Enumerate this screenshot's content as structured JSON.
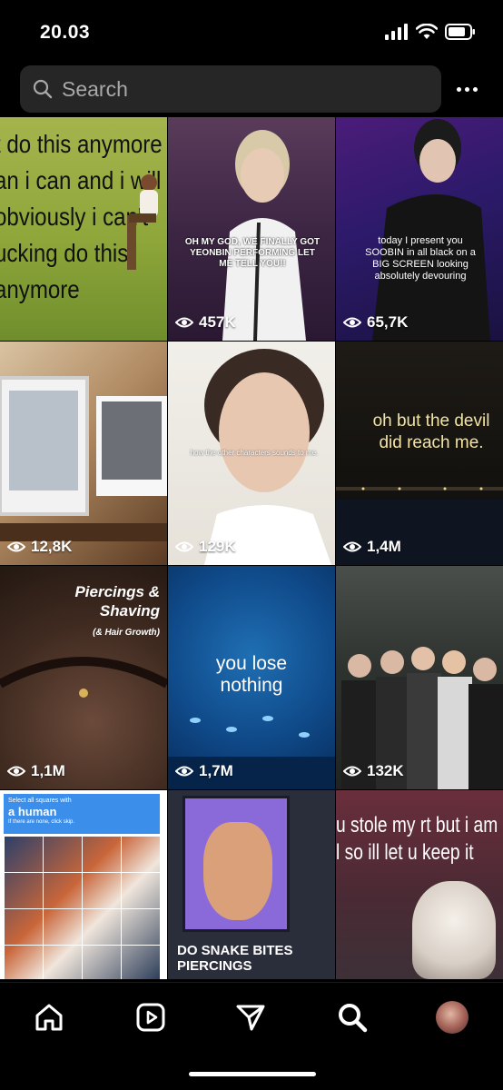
{
  "status_bar": {
    "time": "20.03"
  },
  "search": {
    "placeholder": "Search"
  },
  "grid": {
    "tiles": [
      {
        "caption": "t do this anymore an i can and i will obviously i can't ucking do this anymore",
        "views": ""
      },
      {
        "caption": "OH MY GOD, WE FINALLY GOT YEONBIN PERFORMING LET ME TELL YOU!!",
        "views": "457K"
      },
      {
        "caption": "today I present you SOOBIN in all black on a BIG SCREEN looking absolutely devouring",
        "views": "65,7K"
      },
      {
        "caption": "",
        "views": "12,8K"
      },
      {
        "caption": "how the other characters sounds to me.",
        "views": "129K"
      },
      {
        "caption": "oh but the devil did reach me.",
        "views": "1,4M"
      },
      {
        "caption": "Piercings & Shaving",
        "subcaption": "(& Hair Growth)",
        "views": "1,1M"
      },
      {
        "caption": "you lose nothing",
        "views": "1,7M"
      },
      {
        "caption": "",
        "views": "132K"
      },
      {
        "captcha_line1": "Select all squares with",
        "captcha_line2": "a human",
        "captcha_line3": "If there are none, click skip.",
        "views": ""
      },
      {
        "caption": "DO SNAKE BITES PIERCINGS",
        "views": ""
      },
      {
        "caption": "u stole my rt but i am l so ill let u keep it",
        "views": ""
      }
    ]
  },
  "tab_bar": {
    "items": [
      "home-icon",
      "reels-icon",
      "send-icon",
      "search-icon",
      "profile-avatar"
    ]
  },
  "colors": {
    "background": "#000000",
    "search_bg": "#262626",
    "placeholder": "#a8a8a8"
  }
}
